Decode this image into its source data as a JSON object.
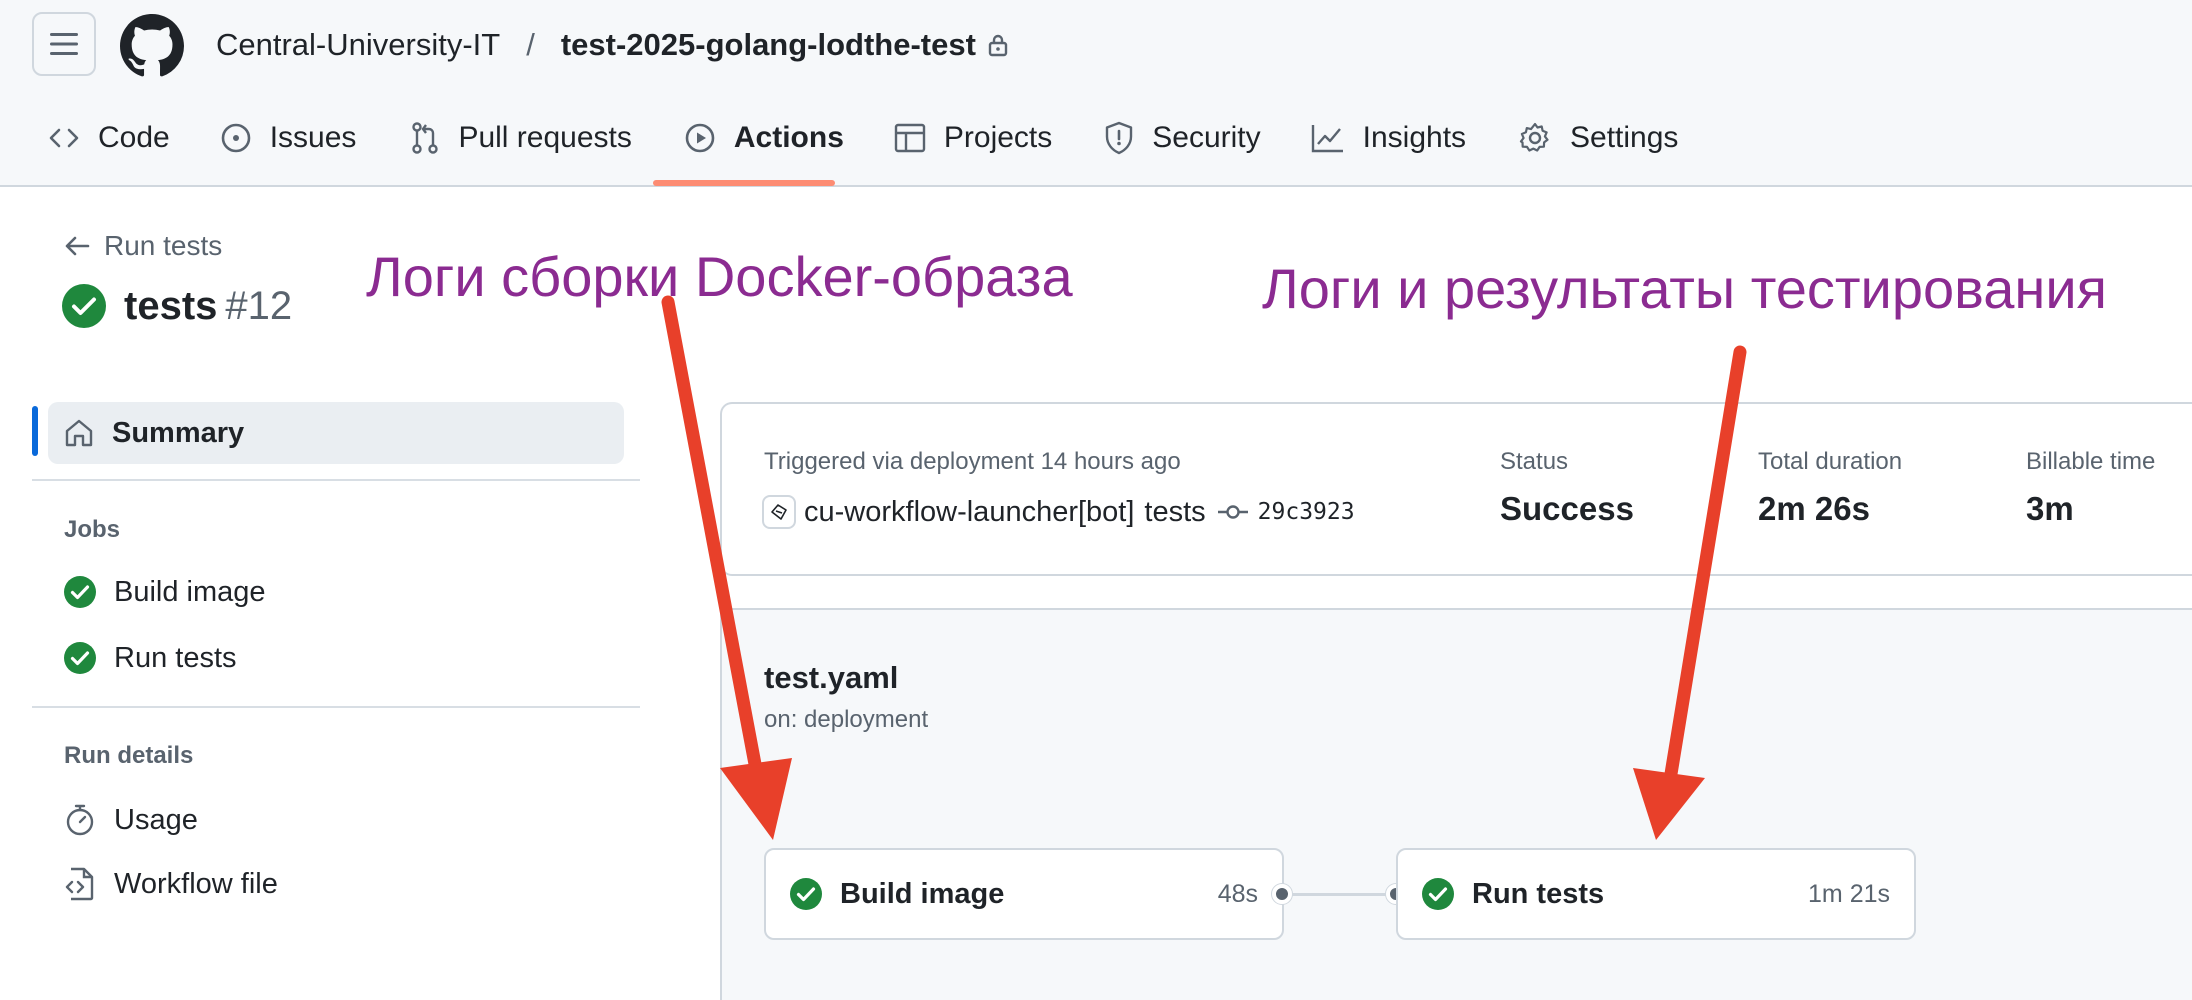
{
  "header": {
    "owner": "Central-University-IT",
    "separator": "/",
    "repo": "test-2025-golang-lodthe-test"
  },
  "nav": {
    "code": "Code",
    "issues": "Issues",
    "pull_requests": "Pull requests",
    "actions": "Actions",
    "projects": "Projects",
    "security": "Security",
    "insights": "Insights",
    "settings": "Settings"
  },
  "sidebar": {
    "back_label": "Run tests",
    "run_name": "tests",
    "run_number": "#12",
    "summary_label": "Summary",
    "jobs_title": "Jobs",
    "jobs": [
      "Build image",
      "Run tests"
    ],
    "run_details_title": "Run details",
    "usage_label": "Usage",
    "workflow_file_label": "Workflow file"
  },
  "summary": {
    "triggered": "Triggered via deployment 14 hours ago",
    "actor": "cu-workflow-launcher[bot]",
    "event": "tests",
    "commit": "29c3923",
    "status_label": "Status",
    "status_value": "Success",
    "duration_label": "Total duration",
    "duration_value": "2m 26s",
    "billable_label": "Billable time",
    "billable_value": "3m"
  },
  "workflow": {
    "file": "test.yaml",
    "trigger": "on: deployment",
    "jobs": [
      {
        "name": "Build image",
        "duration": "48s"
      },
      {
        "name": "Run tests",
        "duration": "1m 21s"
      }
    ]
  },
  "annotations": {
    "left": "Логи сборки Docker-образа",
    "right": "Логи и результаты тестирования",
    "arrow_color": "#e8402a"
  },
  "colors": {
    "success": "#1f883d",
    "accent": "#0969da",
    "nav_underline": "#fd8c73",
    "annotation_text": "#8b2b91"
  }
}
